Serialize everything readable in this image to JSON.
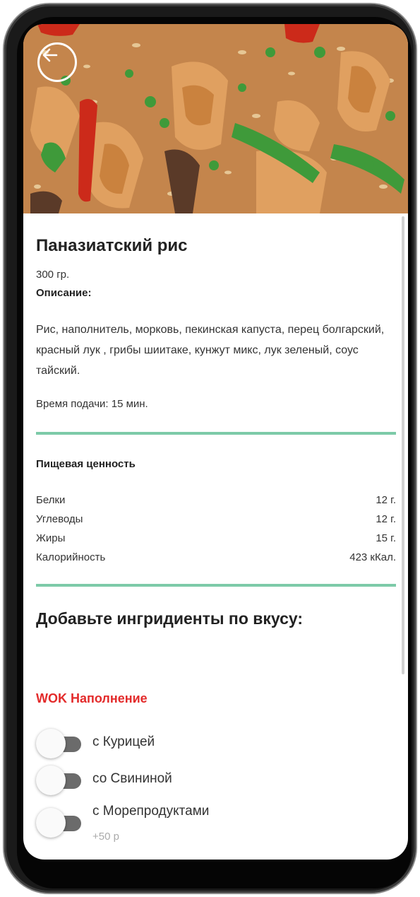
{
  "product": {
    "title": "Паназиатский рис",
    "weight": "300 гр.",
    "description_label": "Описание:",
    "description": "Рис, наполнитель, морковь, пекинская капуста, перец болгарский, красный лук , грибы шиитаке, кунжут микс, лук зеленый, соус тайский.",
    "serving_time": "Время подачи: 15 мин."
  },
  "nutrition": {
    "title": "Пищевая ценность",
    "rows": [
      {
        "label": "Белки",
        "value": "12 г."
      },
      {
        "label": "Углеводы",
        "value": "12 г."
      },
      {
        "label": "Жиры",
        "value": "15 г."
      },
      {
        "label": "Калорийность",
        "value": "423 кКал."
      }
    ]
  },
  "addons": {
    "title": "Добавьте ингридиенты по вкусу:",
    "group_title": "WOK Наполнение",
    "options": [
      {
        "label": "с Курицей",
        "price": "",
        "enabled": false
      },
      {
        "label": "со Свининой",
        "price": "",
        "enabled": false
      },
      {
        "label": "с Морепродуктами",
        "price": "+50 р",
        "enabled": false
      }
    ]
  },
  "icons": {
    "back": "arrow-left-circle-icon"
  },
  "colors": {
    "accent_divider": "#7dcaa8",
    "group_title": "#e32b2b",
    "toggle_track": "#6b6b6b"
  }
}
